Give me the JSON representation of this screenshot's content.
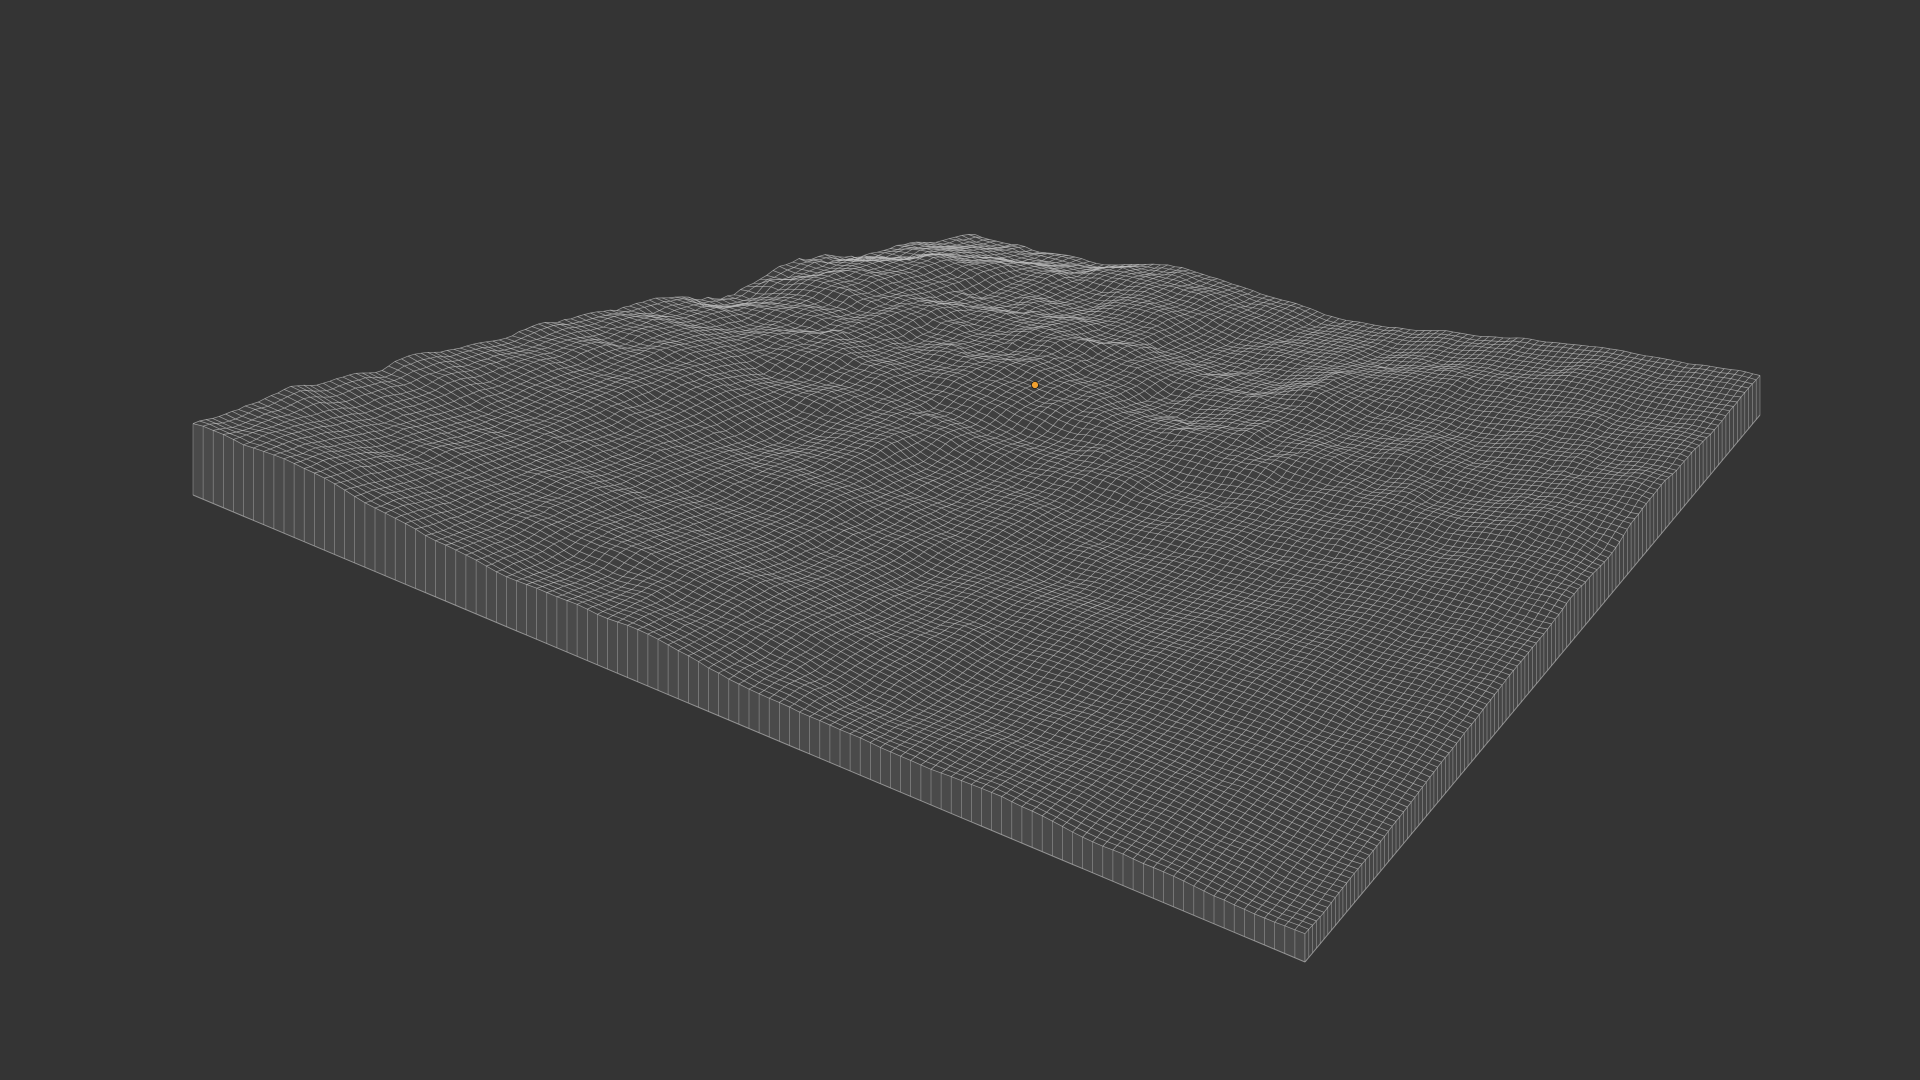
{
  "viewport": {
    "background_color": "#343434",
    "wireframe_color": "#bdbdbd",
    "side_wire_color": "#a9a9a9",
    "selection_color": "#f0a030"
  },
  "terrain_mesh": {
    "object_type": "terrain-wireframe-mesh",
    "render_mode": "wireframe",
    "has_base_thickness": true,
    "selected_origin_marker_visible": true
  }
}
